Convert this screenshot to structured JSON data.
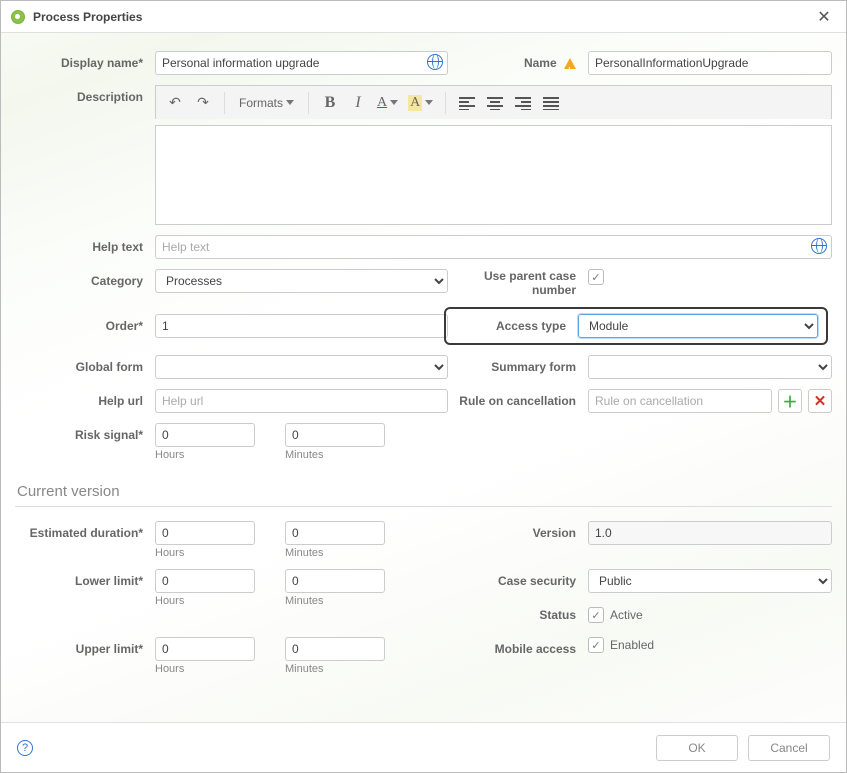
{
  "window": {
    "title": "Process Properties"
  },
  "labels": {
    "display_name": "Display name*",
    "name": "Name",
    "description": "Description",
    "help_text": "Help text",
    "category": "Category",
    "use_parent": "Use parent case number",
    "order": "Order*",
    "access_type": "Access type",
    "global_form": "Global form",
    "summary_form": "Summary form",
    "help_url": "Help url",
    "rule_cancel": "Rule on cancellation",
    "risk_signal": "Risk signal*",
    "hours": "Hours",
    "minutes": "Minutes",
    "est_duration": "Estimated duration*",
    "lower_limit": "Lower limit*",
    "upper_limit": "Upper limit*",
    "version": "Version",
    "case_security": "Case security",
    "status": "Status",
    "mobile_access": "Mobile access",
    "active": "Active",
    "enabled": "Enabled"
  },
  "values": {
    "display_name": "Personal information upgrade",
    "name": "PersonalInformationUpgrade",
    "category": "Processes",
    "order": "1",
    "access_type": "Module",
    "risk_hours": "0",
    "risk_minutes": "0",
    "est_hours": "0",
    "est_minutes": "0",
    "low_hours": "0",
    "low_minutes": "0",
    "up_hours": "0",
    "up_minutes": "0",
    "version": "1.0",
    "case_security": "Public",
    "global_form": "",
    "summary_form": ""
  },
  "placeholders": {
    "help_text": "Help text",
    "help_url": "Help url",
    "rule_cancel": "Rule on cancellation"
  },
  "sections": {
    "current_version": "Current version"
  },
  "editor": {
    "formats": "Formats"
  },
  "footer": {
    "ok": "OK",
    "cancel": "Cancel"
  },
  "checkboxes": {
    "use_parent": true,
    "status_active": true,
    "mobile_enabled": true
  }
}
